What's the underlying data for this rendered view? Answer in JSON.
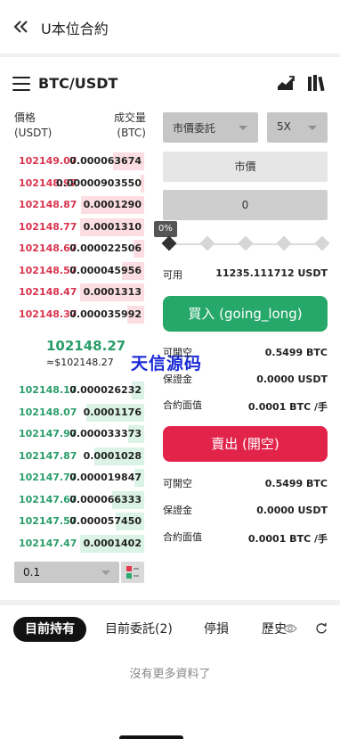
{
  "header": {
    "title": "U本位合約"
  },
  "market": {
    "pair": "BTC/USDT"
  },
  "orderbook": {
    "price_header": [
      "價格",
      "(USDT)"
    ],
    "qty_header": [
      "成交量",
      "(BTC)"
    ],
    "asks": [
      {
        "price": "102149.07",
        "qty": "0.000063674",
        "depth": 0.48
      },
      {
        "price": "102148.97",
        "qty": "0.00000903550",
        "depth": 0.06
      },
      {
        "price": "102148.87",
        "qty": "0.0001290",
        "depth": 0.98
      },
      {
        "price": "102148.77",
        "qty": "0.0001310",
        "depth": 1.0
      },
      {
        "price": "102148.67",
        "qty": "0.000022506",
        "depth": 0.17
      },
      {
        "price": "102148.57",
        "qty": "0.000045956",
        "depth": 0.35
      },
      {
        "price": "102148.47",
        "qty": "0.0001313",
        "depth": 1.0
      },
      {
        "price": "102148.37",
        "qty": "0.000035992",
        "depth": 0.27
      }
    ],
    "last_price": "102148.27",
    "last_fiat": "≈$102148.27",
    "bids": [
      {
        "price": "102148.17",
        "qty": "0.000026232",
        "depth": 0.2
      },
      {
        "price": "102148.07",
        "qty": "0.0001176",
        "depth": 0.9
      },
      {
        "price": "102147.97",
        "qty": "0.000033373",
        "depth": 0.25
      },
      {
        "price": "102147.87",
        "qty": "0.0001028",
        "depth": 0.78
      },
      {
        "price": "102147.77",
        "qty": "0.000019847",
        "depth": 0.15
      },
      {
        "price": "102147.67",
        "qty": "0.000066333",
        "depth": 0.5
      },
      {
        "price": "102147.57",
        "qty": "0.000057450",
        "depth": 0.44
      },
      {
        "price": "102147.47",
        "qty": "0.0001402",
        "depth": 1.0
      }
    ],
    "depth_select": "0.1"
  },
  "watermark": "天信源码",
  "order_form": {
    "order_type": "市價委託",
    "leverage": "5X",
    "price_field": "市價",
    "amount_field": "0",
    "slider_pct": "0%",
    "available_label": "可用",
    "available_value": "11235.111712 USDT",
    "buy_button": "買入 (going_long)",
    "buy_info": [
      {
        "label": "可開空",
        "value": "0.5499 BTC"
      },
      {
        "label": "保證金",
        "value": "0.0000 USDT"
      },
      {
        "label": "合約面值",
        "value": "0.0001 BTC /手"
      }
    ],
    "sell_button": "賣出 (開空)",
    "sell_info": [
      {
        "label": "可開空",
        "value": "0.5499 BTC"
      },
      {
        "label": "保證金",
        "value": "0.0000 USDT"
      },
      {
        "label": "合約面值",
        "value": "0.0001 BTC /手"
      }
    ]
  },
  "tabs": [
    {
      "label": "目前持有"
    },
    {
      "label": "目前委託(2)"
    },
    {
      "label": "停損"
    },
    {
      "label": "歷史"
    }
  ],
  "empty_message": "沒有更多資料了",
  "colors": {
    "buy": "#26a86a",
    "sell": "#e2244a",
    "ask_bar": "#fbdde3",
    "bid_bar": "#dbf3e6"
  }
}
